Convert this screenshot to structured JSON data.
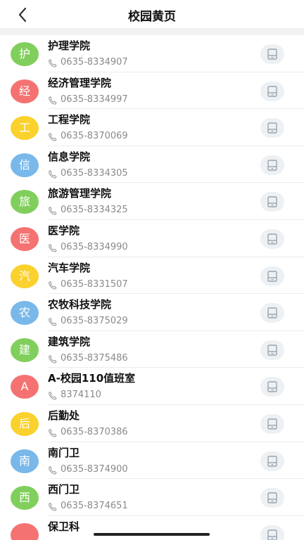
{
  "header": {
    "title": "校园黄页",
    "back_icon": "chevron-left-icon"
  },
  "colors": {
    "green": "#80cf5c",
    "red": "#f47372",
    "yellow": "#fbd12d",
    "blue": "#79b8ea",
    "call_button_bg": "#eef1f4"
  },
  "contacts": [
    {
      "initial": "护",
      "name": "护理学院",
      "phone": "0635-8334907",
      "color": "#80cf5c"
    },
    {
      "initial": "经",
      "name": "经济管理学院",
      "phone": "0635-8334997",
      "color": "#f47372"
    },
    {
      "initial": "工",
      "name": "工程学院",
      "phone": "0635-8370069",
      "color": "#fbd12d"
    },
    {
      "initial": "信",
      "name": "信息学院",
      "phone": "0635-8334305",
      "color": "#79b8ea"
    },
    {
      "initial": "旅",
      "name": "旅游管理学院",
      "phone": "0635-8334325",
      "color": "#80cf5c"
    },
    {
      "initial": "医",
      "name": "医学院",
      "phone": "0635-8334990",
      "color": "#f47372"
    },
    {
      "initial": "汽",
      "name": "汽车学院",
      "phone": "0635-8331507",
      "color": "#fbd12d"
    },
    {
      "initial": "农",
      "name": "农牧科技学院",
      "phone": "0635-8375029",
      "color": "#79b8ea"
    },
    {
      "initial": "建",
      "name": "建筑学院",
      "phone": "0635-8375486",
      "color": "#80cf5c"
    },
    {
      "initial": "A",
      "name": "A-校园110值班室",
      "phone": "8374110",
      "color": "#f47372"
    },
    {
      "initial": "后",
      "name": "后勤处",
      "phone": "0635-8370386",
      "color": "#fbd12d"
    },
    {
      "initial": "南",
      "name": "南门卫",
      "phone": "0635-8374900",
      "color": "#79b8ea"
    },
    {
      "initial": "西",
      "name": "西门卫",
      "phone": "0635-8374651",
      "color": "#80cf5c"
    },
    {
      "initial": "",
      "name": "保卫科",
      "phone": "",
      "color": "#f47372"
    }
  ]
}
